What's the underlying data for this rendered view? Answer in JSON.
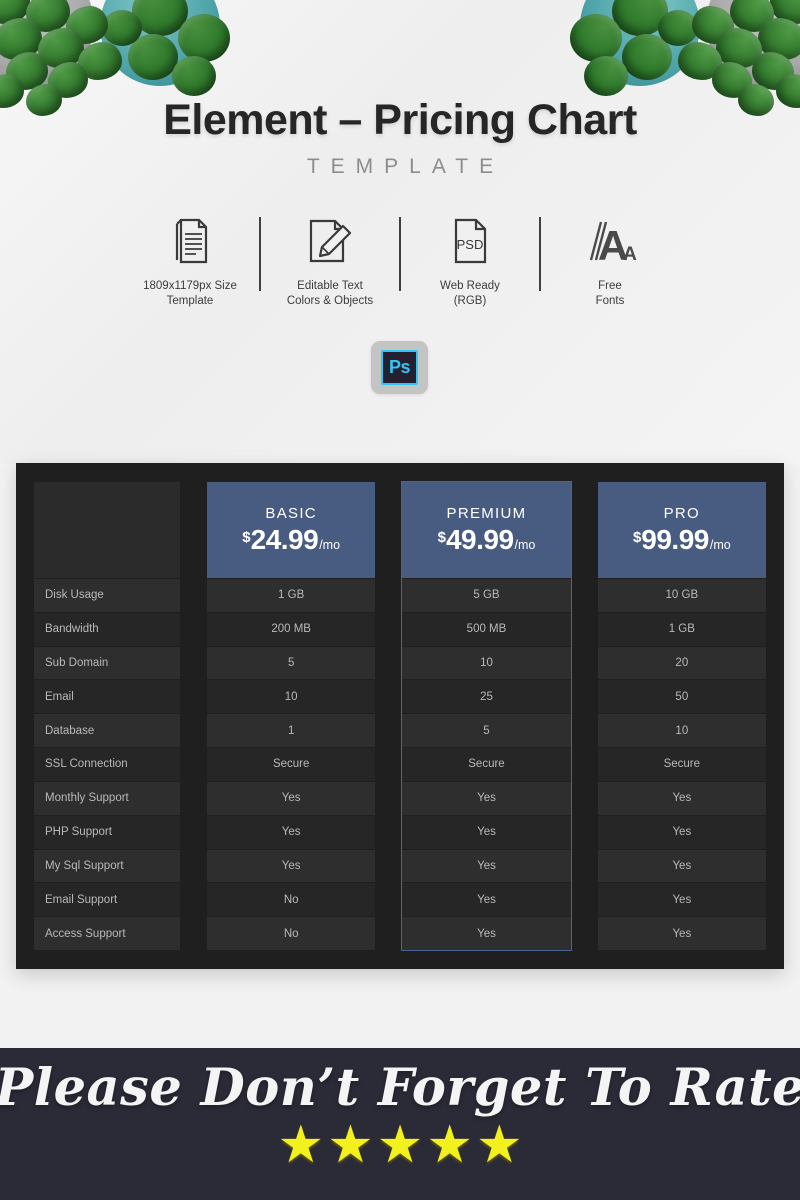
{
  "hero": {
    "title": "Element – Pricing Chart",
    "subtitle": "TEMPLATE",
    "ps_badge_label": "Ps",
    "features": [
      {
        "icon": "document-lines-icon",
        "label": "1809x1179px Size\nTemplate"
      },
      {
        "icon": "pencil-edit-document-icon",
        "label": "Editable Text\nColors & Objects"
      },
      {
        "icon": "psd-file-icon",
        "label": "Web Ready\n(RGB)"
      },
      {
        "icon": "font-letter-a-icon",
        "label": "Free\nFonts"
      }
    ]
  },
  "pricing": {
    "accent_color": "#485b80",
    "highlight_border_color": "#4a6594",
    "frame_color": "#1f1f1f",
    "row_odd_color": "#2e2e2e",
    "row_even_color": "#262626",
    "currency_symbol": "$",
    "period_label": "/mo",
    "plans": [
      {
        "name": "BASIC",
        "price": "24.99",
        "highlighted": false
      },
      {
        "name": "PREMIUM",
        "price": "49.99",
        "highlighted": true
      },
      {
        "name": "PRO",
        "price": "99.99",
        "highlighted": false
      }
    ],
    "features": [
      "Disk Usage",
      "Bandwidth",
      "Sub Domain",
      "Email",
      "Database",
      "SSL Connection",
      "Monthly Support",
      "PHP Support",
      "My Sql Support",
      "Email Support",
      "Access Support"
    ],
    "values": {
      "basic": [
        "1 GB",
        "200 MB",
        "5",
        "10",
        "1",
        "Secure",
        "Yes",
        "Yes",
        "Yes",
        "No",
        "No"
      ],
      "premium": [
        "5 GB",
        "500 MB",
        "10",
        "25",
        "5",
        "Secure",
        "Yes",
        "Yes",
        "Yes",
        "Yes",
        "Yes"
      ],
      "pro": [
        "10 GB",
        "1 GB",
        "20",
        "50",
        "10",
        "Secure",
        "Yes",
        "Yes",
        "Yes",
        "Yes",
        "Yes"
      ]
    }
  },
  "rate_banner": {
    "text": "Please Don’t Forget To Rate",
    "star_count": 5,
    "star_glyph": "★",
    "star_color": "#f2f01d",
    "background_color": "#2b2b38"
  }
}
